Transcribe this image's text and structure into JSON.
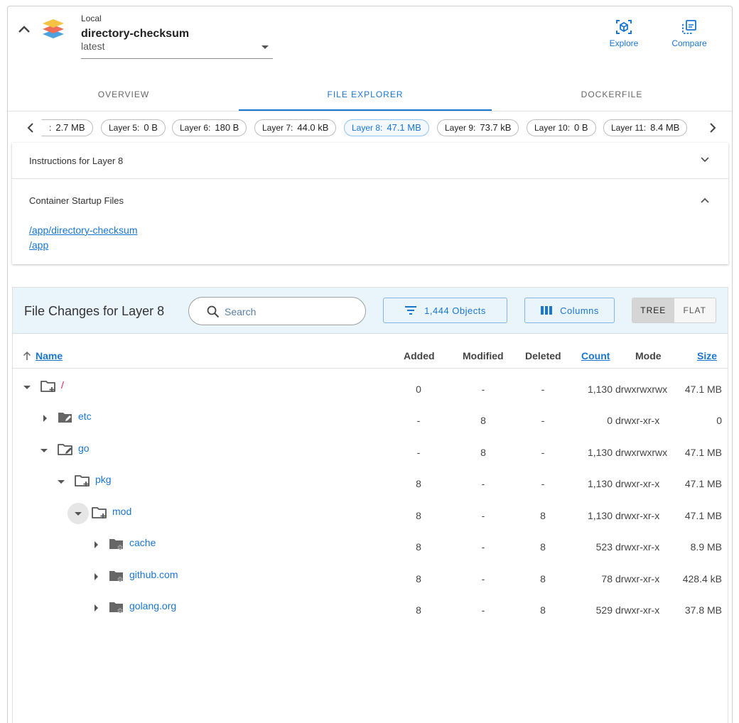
{
  "header": {
    "source_label": "Local",
    "image_name": "directory-checksum",
    "tag_value": "latest",
    "actions": [
      {
        "label": "Explore",
        "icon": "explore-cube-icon"
      },
      {
        "label": "Compare",
        "icon": "compare-icon"
      }
    ]
  },
  "tabs": [
    {
      "label": "OVERVIEW",
      "active": false
    },
    {
      "label": "FILE EXPLORER",
      "active": true
    },
    {
      "label": "DOCKERFILE",
      "active": false
    }
  ],
  "layers": [
    {
      "label": ":",
      "size": "2.7 MB"
    },
    {
      "label": "Layer 5:",
      "size": "0 B"
    },
    {
      "label": "Layer 6:",
      "size": "180 B"
    },
    {
      "label": "Layer 7:",
      "size": "44.0 kB"
    },
    {
      "label": "Layer 8:",
      "size": "47.1 MB",
      "selected": true
    },
    {
      "label": "Layer 9:",
      "size": "73.7 kB"
    },
    {
      "label": "Layer 10:",
      "size": "0 B"
    },
    {
      "label": "Layer 11:",
      "size": "8.4 MB"
    }
  ],
  "instructions": {
    "title": "Instructions for Layer 8"
  },
  "startup": {
    "title": "Container Startup Files",
    "files": [
      "/app/directory-checksum",
      "/app"
    ]
  },
  "file_changes": {
    "title": "File Changes for Layer 8",
    "search_placeholder": "Search",
    "objects_label": "1,444 Objects",
    "columns_label": "Columns",
    "view_modes": [
      "TREE",
      "FLAT"
    ],
    "view_mode_active": "TREE",
    "headers": {
      "name": "Name",
      "added": "Added",
      "modified": "Modified",
      "deleted": "Deleted",
      "count": "Count",
      "mode": "Mode",
      "size": "Size"
    },
    "rows": [
      {
        "name": "/",
        "added": "0",
        "modified": "-",
        "deleted": "-",
        "count": "1,130",
        "mode": "drwxrwxrwx",
        "size": "47.1 MB"
      },
      {
        "name": "etc",
        "added": "-",
        "modified": "8",
        "deleted": "-",
        "count": "0",
        "mode": "drwxr-xr-x",
        "size": "0"
      },
      {
        "name": "go",
        "added": "-",
        "modified": "8",
        "deleted": "-",
        "count": "1,130",
        "mode": "drwxrwxrwx",
        "size": "47.1 MB"
      },
      {
        "name": "pkg",
        "added": "8",
        "modified": "-",
        "deleted": "-",
        "count": "1,130",
        "mode": "drwxr-xr-x",
        "size": "47.1 MB"
      },
      {
        "name": "mod",
        "added": "8",
        "modified": "-",
        "deleted": "8",
        "count": "1,130",
        "mode": "drwxr-xr-x",
        "size": "47.1 MB"
      },
      {
        "name": "cache",
        "added": "8",
        "modified": "-",
        "deleted": "8",
        "count": "523",
        "mode": "drwxr-xr-x",
        "size": "8.9 MB"
      },
      {
        "name": "github.com",
        "added": "8",
        "modified": "-",
        "deleted": "8",
        "count": "78",
        "mode": "drwxr-xr-x",
        "size": "428.4 kB"
      },
      {
        "name": "golang.org",
        "added": "8",
        "modified": "-",
        "deleted": "8",
        "count": "529",
        "mode": "drwxr-xr-x",
        "size": "37.8 MB"
      }
    ]
  },
  "colors": {
    "accent": "#1976d2",
    "root_name": "#e91e63",
    "panel_header": "#eaf4fb"
  }
}
